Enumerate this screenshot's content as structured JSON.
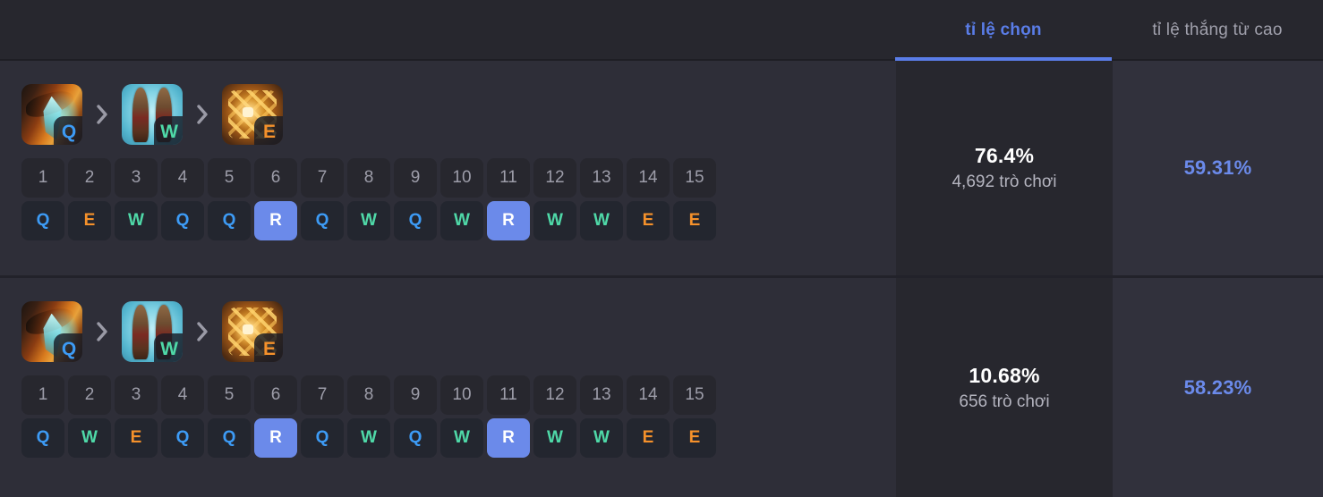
{
  "header": {
    "tabs": [
      {
        "label": "tỉ lệ chọn",
        "active": true
      },
      {
        "label": "tỉ lệ thắng từ cao",
        "active": false
      }
    ]
  },
  "colors": {
    "accent_blue": "#5a7de8",
    "highlight_blue": "#6b8aea",
    "skill_q": "#3d9bf5",
    "skill_w": "#4fd9a8",
    "skill_e": "#f5912b",
    "skill_r": "#ffffff",
    "row_bg": "#2e2e38",
    "header_bg": "#27272e",
    "pick_col_bg": "#27272e",
    "win_col_bg": "#31313c"
  },
  "levels": [
    "1",
    "2",
    "3",
    "4",
    "5",
    "6",
    "7",
    "8",
    "9",
    "10",
    "11",
    "12",
    "13",
    "14",
    "15"
  ],
  "rows": [
    {
      "priority": [
        {
          "key": "Q",
          "icon": "ability-icon-q"
        },
        {
          "key": "W",
          "icon": "ability-icon-w"
        },
        {
          "key": "E",
          "icon": "ability-icon-e"
        }
      ],
      "separator": "chevron-right-icon",
      "skill_order": [
        "Q",
        "E",
        "W",
        "Q",
        "Q",
        "R",
        "Q",
        "W",
        "Q",
        "W",
        "R",
        "W",
        "W",
        "E",
        "E"
      ],
      "pick_rate": "76.4%",
      "games": "4,692 trò chơi",
      "win_rate": "59.31%"
    },
    {
      "priority": [
        {
          "key": "Q",
          "icon": "ability-icon-q"
        },
        {
          "key": "W",
          "icon": "ability-icon-w"
        },
        {
          "key": "E",
          "icon": "ability-icon-e"
        }
      ],
      "separator": "chevron-right-icon",
      "skill_order": [
        "Q",
        "W",
        "E",
        "Q",
        "Q",
        "R",
        "Q",
        "W",
        "Q",
        "W",
        "R",
        "W",
        "W",
        "E",
        "E"
      ],
      "pick_rate": "10.68%",
      "games": "656 trò chơi",
      "win_rate": "58.23%"
    }
  ]
}
